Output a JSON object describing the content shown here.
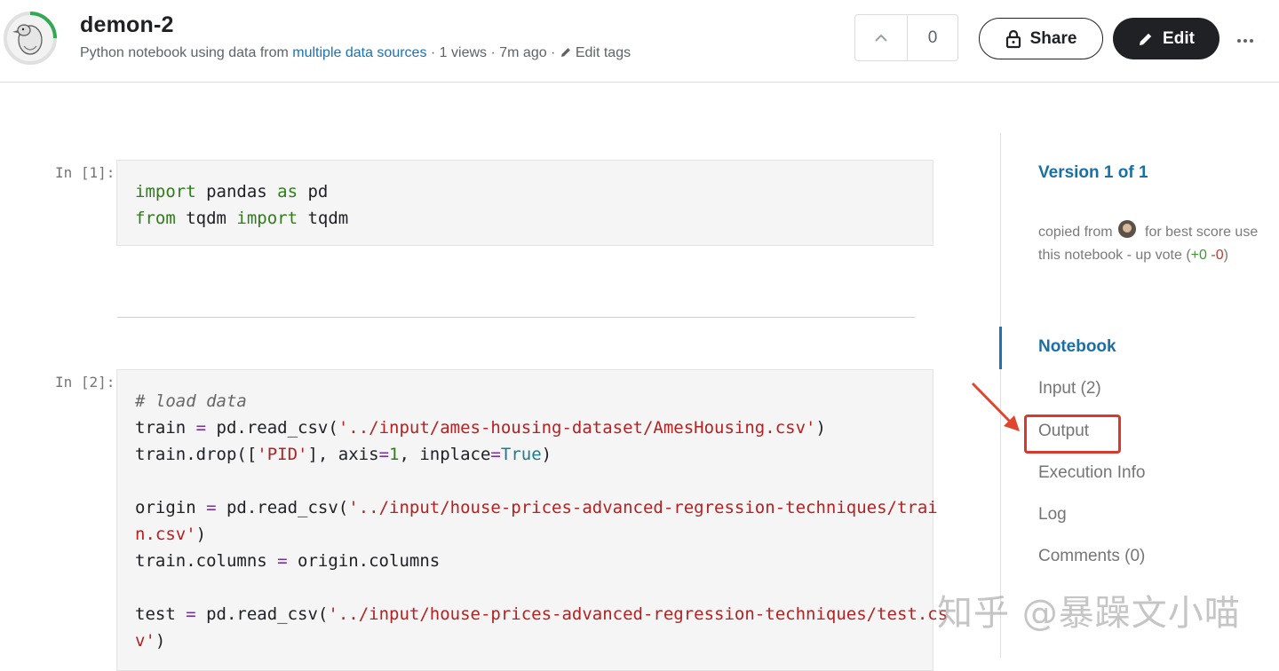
{
  "header": {
    "title": "demon-2",
    "meta_prefix": "Python notebook using data from ",
    "meta_link": "multiple data sources",
    "meta_views": " · 1 views · 7m ago · ",
    "edit_tags": "Edit tags",
    "vote_count": "0",
    "share_label": "Share",
    "edit_label": "Edit"
  },
  "cells": [
    {
      "prompt": "In [1]:",
      "lines": [
        [
          {
            "t": "import",
            "c": "kw"
          },
          {
            "t": " pandas "
          },
          {
            "t": "as",
            "c": "kw"
          },
          {
            "t": " pd"
          }
        ],
        [
          {
            "t": "from",
            "c": "kw"
          },
          {
            "t": " tqdm "
          },
          {
            "t": "import",
            "c": "kw"
          },
          {
            "t": " tqdm"
          }
        ]
      ]
    },
    {
      "prompt": "In [2]:",
      "lines": [
        [
          {
            "t": "# load data",
            "c": "cm"
          }
        ],
        [
          {
            "t": "train "
          },
          {
            "t": "=",
            "c": "op"
          },
          {
            "t": " pd.read_csv("
          },
          {
            "t": "'../input/ames-housing-dataset/AmesHousing.csv'",
            "c": "str"
          },
          {
            "t": ")"
          }
        ],
        [
          {
            "t": "train.drop(["
          },
          {
            "t": "'PID'",
            "c": "str"
          },
          {
            "t": "], axis"
          },
          {
            "t": "=",
            "c": "op"
          },
          {
            "t": "1",
            "c": "num"
          },
          {
            "t": ", inplace"
          },
          {
            "t": "=",
            "c": "op"
          },
          {
            "t": "True",
            "c": "bi"
          },
          {
            "t": ")"
          }
        ],
        [
          {
            "t": ""
          }
        ],
        [
          {
            "t": "origin "
          },
          {
            "t": "=",
            "c": "op"
          },
          {
            "t": " pd.read_csv("
          },
          {
            "t": "'../input/house-prices-advanced-regression-techniques/trai",
            "c": "str"
          }
        ],
        [
          {
            "t": "n.csv'",
            "c": "str"
          },
          {
            "t": ")"
          }
        ],
        [
          {
            "t": "train.columns "
          },
          {
            "t": "=",
            "c": "op"
          },
          {
            "t": " origin.columns"
          }
        ],
        [
          {
            "t": ""
          }
        ],
        [
          {
            "t": "test "
          },
          {
            "t": "=",
            "c": "op"
          },
          {
            "t": " pd.read_csv("
          },
          {
            "t": "'../input/house-prices-advanced-regression-techniques/test.cs",
            "c": "str"
          }
        ],
        [
          {
            "t": "v'",
            "c": "str"
          },
          {
            "t": ")"
          }
        ]
      ]
    }
  ],
  "sidebar": {
    "version": "Version 1 of 1",
    "copied_from": "copied from",
    "copied_rest": " for best score use this notebook - up vote (",
    "plus": "+0",
    "minus": "-0",
    "close_paren": ")",
    "nav": [
      {
        "label": "Notebook",
        "active": true
      },
      {
        "label": "Input (2)",
        "active": false
      },
      {
        "label": "Output",
        "active": false
      },
      {
        "label": "Execution Info",
        "active": false
      },
      {
        "label": "Log",
        "active": false
      },
      {
        "label": "Comments (0)",
        "active": false
      }
    ]
  },
  "watermark": "知乎 @暴躁文小喵",
  "colors": {
    "accent": "#1a6fa6",
    "highlight": "#d63a2f",
    "edit_button": "#202124"
  },
  "icons": [
    "goose-avatar-icon",
    "pencil-icon",
    "chevron-up-icon",
    "lock-icon",
    "pencil-icon",
    "more-icon",
    "arrow-icon"
  ]
}
